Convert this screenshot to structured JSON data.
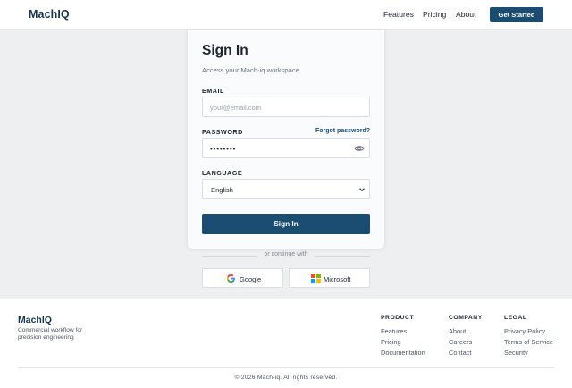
{
  "nav": {
    "brand": "MachIQ",
    "links": [
      {
        "label": "Features"
      },
      {
        "label": "Pricing"
      },
      {
        "label": "About"
      }
    ],
    "cta": "Get Started"
  },
  "signin": {
    "title": "Sign In",
    "subtitle": "Access your Mach-iq workspace",
    "email_label": "EMAIL",
    "email_placeholder": "your@email.com",
    "password_label": "PASSWORD",
    "forgot": "Forgot password?",
    "password_value": "••••••••",
    "language_label": "LANGUAGE",
    "language_value": "English",
    "submit": "Sign In"
  },
  "alt_login": {
    "divider": "or continue with",
    "google": "Google",
    "microsoft": "Microsoft"
  },
  "footer": {
    "brand": "MachIQ",
    "tagline": "Commercial workflow for precision engineering",
    "columns": [
      {
        "heading": "PRODUCT",
        "links": [
          "Features",
          "Pricing",
          "Documentation"
        ]
      },
      {
        "heading": "COMPANY",
        "links": [
          "About",
          "Careers",
          "Contact"
        ]
      },
      {
        "heading": "LEGAL",
        "links": [
          "Privacy Policy",
          "Terms of Service",
          "Security"
        ]
      }
    ],
    "copyright": "© 2026 Mach-iq. All rights reserved."
  },
  "colors": {
    "brand": "#16324f",
    "primary": "#1b4d72",
    "background": "#eeeff1"
  },
  "icons": [
    "eye-icon",
    "chevron-down-icon",
    "google-icon",
    "microsoft-icon"
  ]
}
